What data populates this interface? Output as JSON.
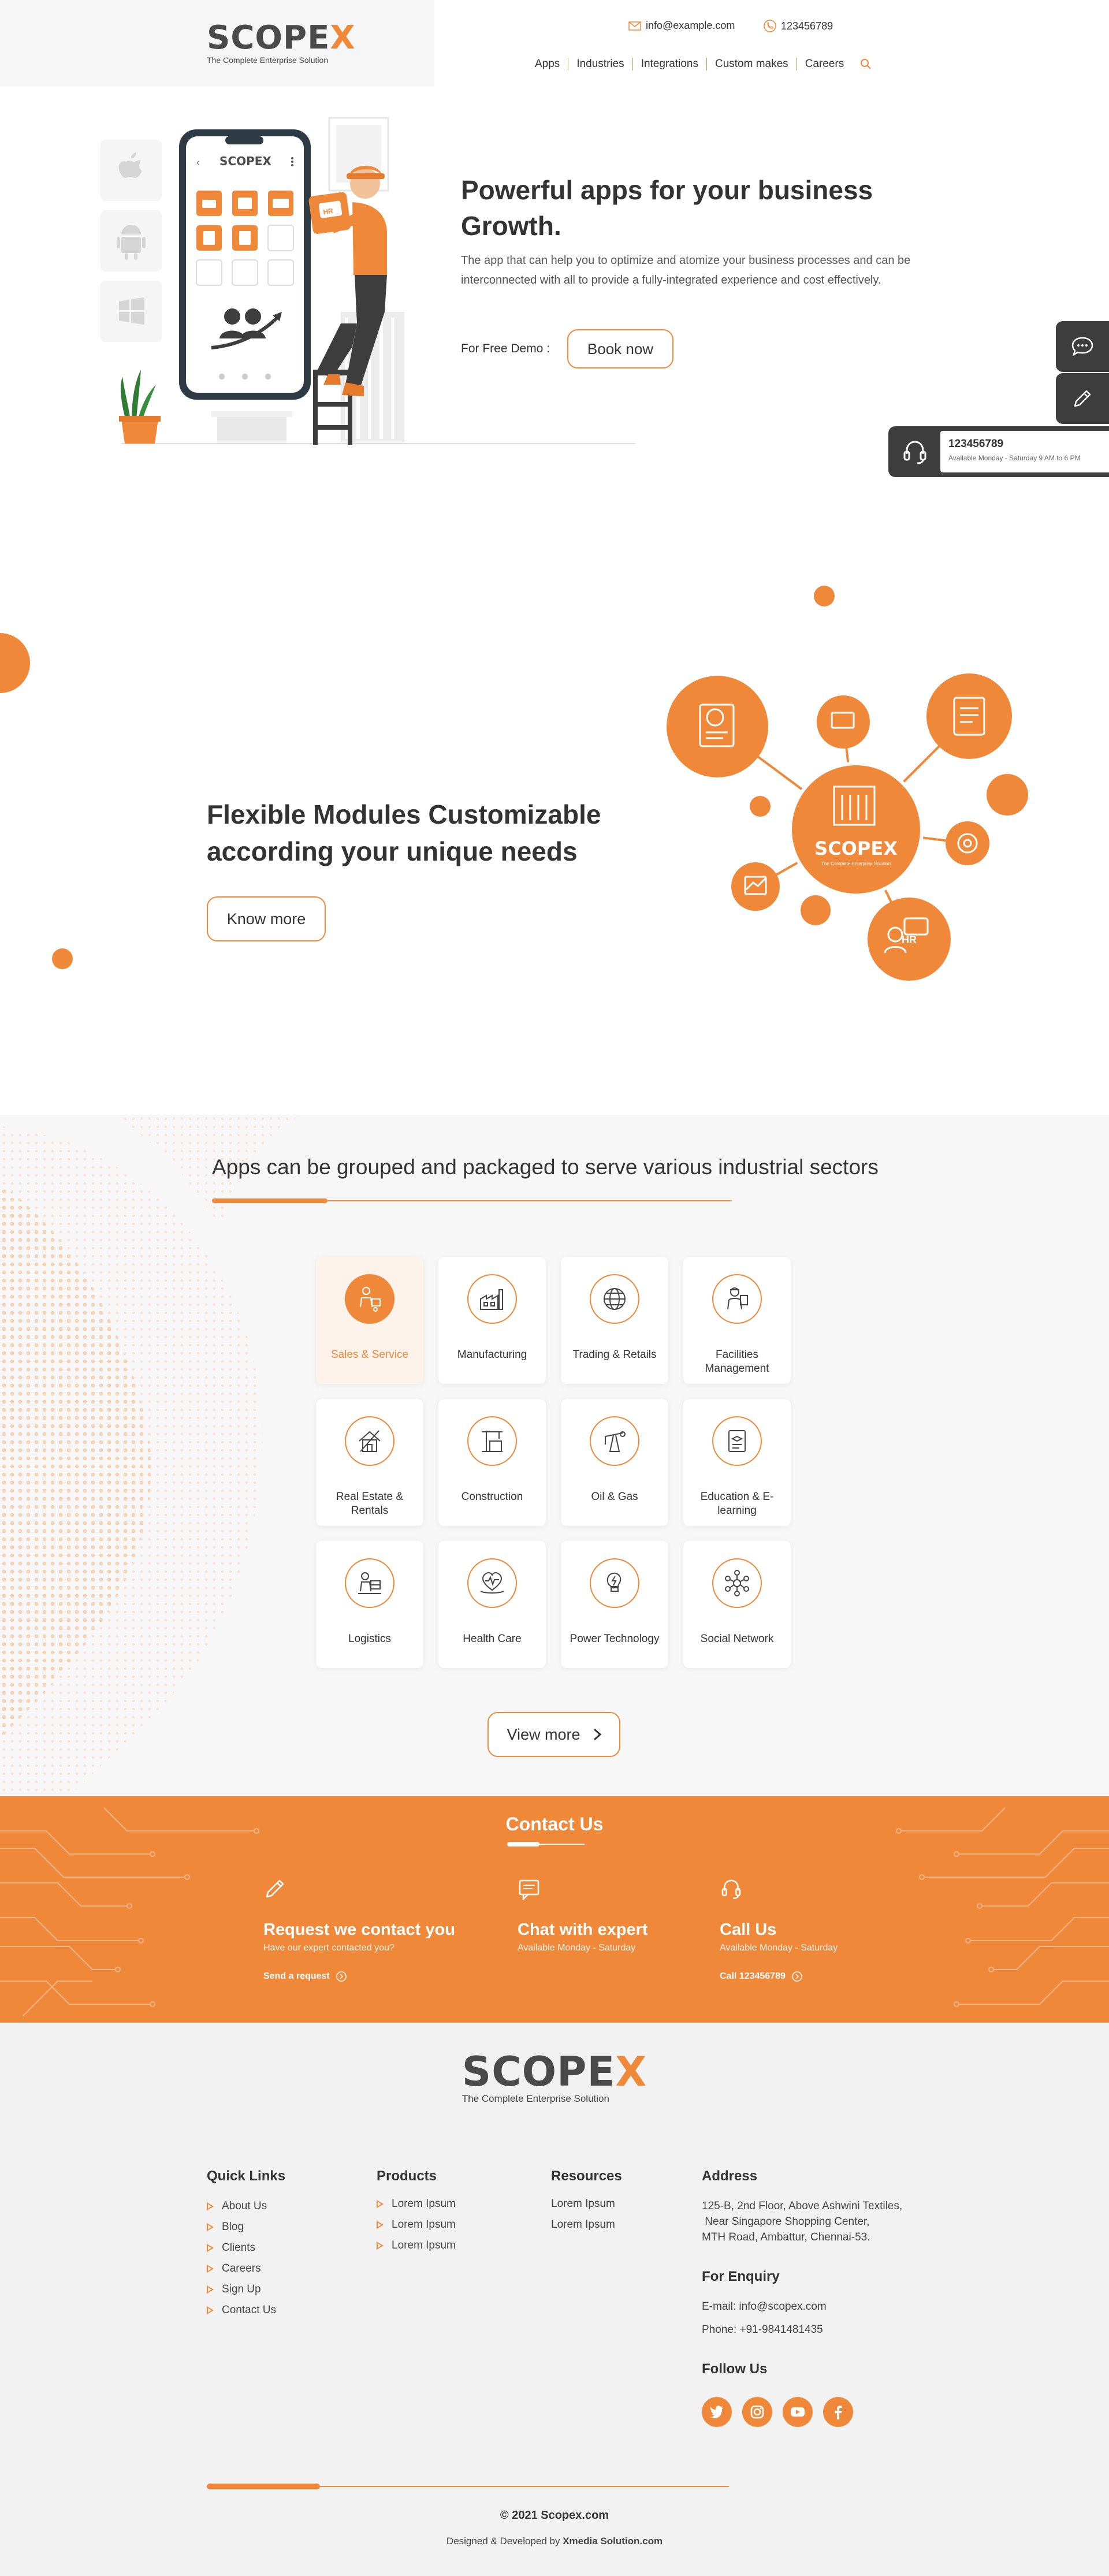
{
  "header": {
    "logo_text": "SCOPE",
    "logo_x": "X",
    "tagline": "The Complete Enterprise Solution",
    "email": "info@example.com",
    "phone": "123456789",
    "nav": [
      "Apps",
      "Industries",
      "Integrations",
      "Custom makes",
      "Careers"
    ]
  },
  "hero": {
    "title_line1": "Powerful apps for your business",
    "title_line2": "Growth.",
    "text": "The app that can help you to optimize and atomize your business processes and can be interconnected with all  to provide a fully-integrated experience and cost effectively.",
    "demo_label": "For Free Demo :",
    "book_button": "Book now",
    "phone_logo": "SCOPEX",
    "badge": "HR"
  },
  "side_widgets": {
    "call_number": "123456789",
    "call_hours": "Available Monday - Saturday 9 AM to 6 PM"
  },
  "modules": {
    "title_line1": "Flexible Modules Customizable",
    "title_line2": "according your unique needs",
    "button": "Know more",
    "hub_logo": "SCOPEX",
    "hub_tagline": "The Complete Enterprise Solution",
    "hr_badge": "HR"
  },
  "industries": {
    "title": "Apps can be grouped and packaged to serve various industrial sectors",
    "cards": [
      {
        "label": "Sales & Service"
      },
      {
        "label": "Manufacturing"
      },
      {
        "label": "Trading & Retails"
      },
      {
        "label": "Facilities Management"
      },
      {
        "label": "Real Estate & Rentals"
      },
      {
        "label": "Construction"
      },
      {
        "label": "Oil & Gas"
      },
      {
        "label": "Education & E-learning"
      },
      {
        "label": "Logistics"
      },
      {
        "label": "Health Care"
      },
      {
        "label": "Power Technology"
      },
      {
        "label": "Social Network"
      }
    ],
    "view_more": "View more"
  },
  "contact": {
    "title": "Contact Us",
    "items": [
      {
        "heading": "Request we contact you",
        "sub": "Have our expert contacted you?",
        "link": "Send a request"
      },
      {
        "heading": "Chat with expert",
        "sub": "Available Monday - Saturday",
        "link": ""
      },
      {
        "heading": "Call Us",
        "sub": "Available Monday - Saturday",
        "link": "Call 123456789"
      }
    ]
  },
  "footer": {
    "logo_text": "SCOPE",
    "logo_x": "X",
    "tagline": "The Complete Enterprise Solution",
    "quick_links_title": "Quick Links",
    "quick_links": [
      "About Us",
      "Blog",
      "Clients",
      "Careers",
      "Sign Up",
      "Contact Us"
    ],
    "products_title": "Products",
    "products": [
      "Lorem Ipsum",
      "Lorem Ipsum",
      "Lorem Ipsum"
    ],
    "resources_title": "Resources",
    "resources": [
      "Lorem Ipsum",
      "Lorem Ipsum"
    ],
    "address_title": "Address",
    "address_line1": "125-B, 2nd Floor, Above Ashwini Textiles,",
    "address_line2": " Near Singapore Shopping Center,",
    "address_line3": "MTH Road, Ambattur, Chennai-53.",
    "enquiry_title": "For Enquiry",
    "email": "E-mail: info@scopex.com",
    "phone": "Phone: +91-9841481435",
    "follow_title": "Follow Us",
    "copyright": "© 2021   Scopex.com",
    "designed_prefix": "Designed & Developed by ",
    "designed_by": "Xmedia Solution.com"
  },
  "colors": {
    "accent": "#f0883a",
    "dark": "#3d3d3d",
    "text": "#333333",
    "light_bg": "#f2f2f2"
  }
}
